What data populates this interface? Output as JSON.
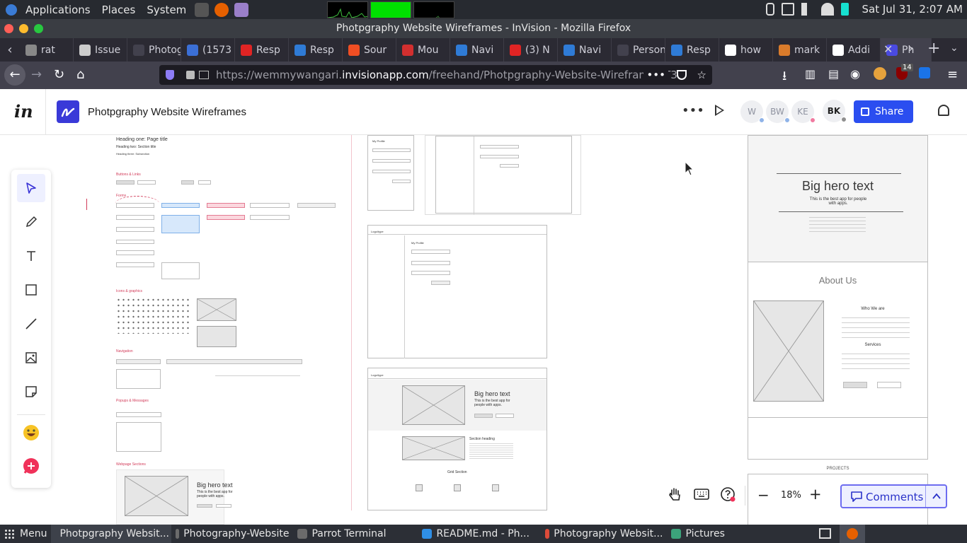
{
  "system_bar": {
    "menus": [
      "Applications",
      "Places",
      "System"
    ],
    "clock": "Sat Jul 31,  2:07 AM"
  },
  "window": {
    "title": "Photpgraphy Website Wireframes - InVision - Mozilla Firefox"
  },
  "tabs": [
    {
      "label": "rat",
      "color": "#888888"
    },
    {
      "label": "Issue",
      "color": "#cccccc"
    },
    {
      "label": "Photogr",
      "color": "#42414d"
    },
    {
      "label": "(1573",
      "color": "#3b6fd6"
    },
    {
      "label": "Resp",
      "color": "#e02424"
    },
    {
      "label": "Resp",
      "color": "#2f7bd6"
    },
    {
      "label": "Sour",
      "color": "#f04e23"
    },
    {
      "label": "Mou",
      "color": "#d22f2f"
    },
    {
      "label": "Navi",
      "color": "#2f7bd6"
    },
    {
      "label": "(3) N",
      "color": "#e02424"
    },
    {
      "label": "Navi",
      "color": "#2f7bd6"
    },
    {
      "label": "Persona",
      "color": "#42414d"
    },
    {
      "label": "Resp",
      "color": "#2f7bd6"
    },
    {
      "label": "how",
      "color": "#ffffff"
    },
    {
      "label": "mark",
      "color": "#d97b2b"
    },
    {
      "label": "Addi",
      "color": "#ffffff"
    },
    {
      "label": "Ph",
      "color": "#4a4ae0"
    }
  ],
  "url": {
    "prefix": "https://wemmywangari.",
    "domain": "invisionapp.com",
    "path": "/freehand/Photpgraphy-Website-Wireframes-T3"
  },
  "toolbar_badges": {
    "extensions_count": "14"
  },
  "invision": {
    "logo": "in",
    "doc_title": "Photpgraphy Website Wireframes",
    "avatars": [
      {
        "initials": "W",
        "dot": "#8fb3e8"
      },
      {
        "initials": "BW",
        "dot": "#8fb3e8"
      },
      {
        "initials": "KE",
        "dot": "#f07aa0"
      },
      {
        "initials": "BK",
        "dot": "#8f8f8f"
      }
    ],
    "share_label": "Share",
    "zoom": "18%",
    "comments_label": "Comments"
  },
  "canvas": {
    "style_guide": {
      "heading1": "Heading one: Page title",
      "heading2": "Heading two: Section title",
      "heading3": "Heading three: Subsection",
      "buttons_links": "Buttons & Links",
      "forms": "Forms",
      "icons_graphics": "Icons & graphics",
      "navigation": "Navigation",
      "popups": "Popups & Messages",
      "webpage_sections": "Webpage Sections",
      "hero_text": "Big hero text",
      "hero_sub": "This is the best app for people with apps."
    },
    "frames": {
      "my_profile": "My Profile",
      "logo": "Logo/type",
      "hero_text": "Big hero text",
      "hero_sub": "This is the best app for people with apps.",
      "section_heading": "Section heading",
      "grid_section": "Grid Section"
    },
    "right_page": {
      "hero_text": "Big hero text",
      "hero_sub": "This is the best app for people with apps.",
      "about": "About Us",
      "who": "Who We are",
      "services": "Services",
      "projects": "PROJECTS"
    }
  },
  "taskbar": {
    "menu": "Menu",
    "items": [
      {
        "label": "Photpgraphy Websit...",
        "color": "#e66000",
        "active": true
      },
      {
        "label": "Photography-Website",
        "color": "#6b6b6b",
        "active": false
      },
      {
        "label": "Parrot Terminal",
        "color": "#6b6b6b",
        "active": false
      },
      {
        "label": "README.md - Ph...",
        "color": "#2f8fe6",
        "active": false
      },
      {
        "label": "Photography Websit...",
        "color": "#dd4b39",
        "active": false
      },
      {
        "label": "Pictures",
        "color": "#3ca37b",
        "active": false
      }
    ]
  }
}
